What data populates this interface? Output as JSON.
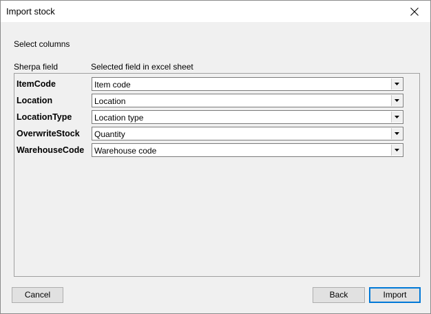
{
  "window": {
    "title": "Import stock"
  },
  "form": {
    "section_label": "Select columns",
    "col_field": "Sherpa field",
    "col_excel": "Selected field in excel sheet",
    "rows": [
      {
        "label": "ItemCode",
        "value": "Item code"
      },
      {
        "label": "Location",
        "value": "Location"
      },
      {
        "label": "LocationType",
        "value": "Location type"
      },
      {
        "label": "OverwriteStock",
        "value": "Quantity"
      },
      {
        "label": "WarehouseCode",
        "value": "Warehouse code"
      }
    ]
  },
  "buttons": {
    "cancel": "Cancel",
    "back": "Back",
    "import": "Import"
  },
  "icons": {
    "close": "close-icon",
    "dropdown": "chevron-down-icon"
  }
}
